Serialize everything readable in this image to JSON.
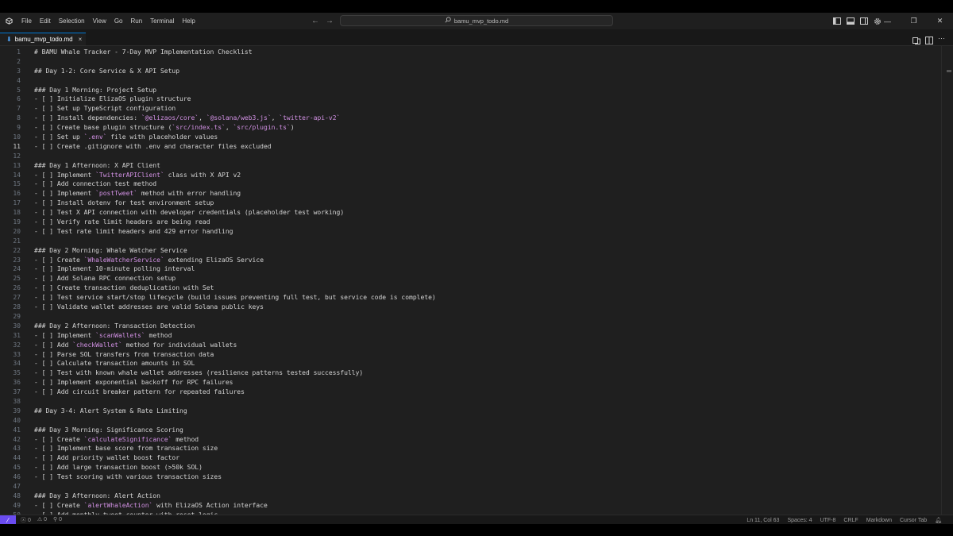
{
  "title_bar": {
    "menu": [
      "File",
      "Edit",
      "Selection",
      "View",
      "Go",
      "Run",
      "Terminal",
      "Help"
    ],
    "search": "bamu_mvp_todo.md"
  },
  "tab": {
    "filename": "bamu_mvp_todo.md",
    "close": "×"
  },
  "editor": {
    "current_line": 11,
    "lines": [
      [
        {
          "t": "# BAMU Whale Tracker - 7-Day MVP Implementation Checklist"
        }
      ],
      [],
      [
        {
          "t": "## Day 1-2: Core Service & X API Setup"
        }
      ],
      [],
      [
        {
          "t": "### Day 1 Morning: Project Setup"
        }
      ],
      [
        {
          "t": "- [ ] Initialize ElizaOS plugin structure"
        }
      ],
      [
        {
          "t": "- [ ] Set up TypeScript configuration"
        }
      ],
      [
        {
          "t": "- [ ] Install dependencies: "
        },
        {
          "t": "`@elizaos/core`",
          "h": 1
        },
        {
          "t": ", "
        },
        {
          "t": "`@solana/web3.js`",
          "h": 1
        },
        {
          "t": ", "
        },
        {
          "t": "`twitter-api-v2`",
          "h": 1
        }
      ],
      [
        {
          "t": "- [ ] Create base plugin structure ("
        },
        {
          "t": "`src/index.ts`",
          "h": 1
        },
        {
          "t": ", "
        },
        {
          "t": "`src/plugin.ts`",
          "h": 1
        },
        {
          "t": ")"
        }
      ],
      [
        {
          "t": "- [ ] Set up "
        },
        {
          "t": "`.env`",
          "h": 1
        },
        {
          "t": " file with placeholder values"
        }
      ],
      [
        {
          "t": "- [ ] Create .gitignore with .env and character files excluded"
        }
      ],
      [],
      [
        {
          "t": "### Day 1 Afternoon: X API Client"
        }
      ],
      [
        {
          "t": "- [ ] Implement "
        },
        {
          "t": "`TwitterAPIClient`",
          "h": 1
        },
        {
          "t": " class with X API v2"
        }
      ],
      [
        {
          "t": "- [ ] Add connection test method"
        }
      ],
      [
        {
          "t": "- [ ] Implement "
        },
        {
          "t": "`postTweet`",
          "h": 1
        },
        {
          "t": " method with error handling"
        }
      ],
      [
        {
          "t": "- [ ] Install dotenv for test environment setup"
        }
      ],
      [
        {
          "t": "- [ ] Test X API connection with developer credentials (placeholder test working)"
        }
      ],
      [
        {
          "t": "- [ ] Verify rate limit headers are being read"
        }
      ],
      [
        {
          "t": "- [ ] Test rate limit headers and 429 error handling"
        }
      ],
      [],
      [
        {
          "t": "### Day 2 Morning: Whale Watcher Service"
        }
      ],
      [
        {
          "t": "- [ ] Create "
        },
        {
          "t": "`WhaleWatcherService`",
          "h": 1
        },
        {
          "t": " extending ElizaOS Service"
        }
      ],
      [
        {
          "t": "- [ ] Implement 10-minute polling interval"
        }
      ],
      [
        {
          "t": "- [ ] Add Solana RPC connection setup"
        }
      ],
      [
        {
          "t": "- [ ] Create transaction deduplication with Set"
        }
      ],
      [
        {
          "t": "- [ ] Test service start/stop lifecycle (build issues preventing full test, but service code is complete)"
        }
      ],
      [
        {
          "t": "- [ ] Validate wallet addresses are valid Solana public keys"
        }
      ],
      [],
      [
        {
          "t": "### Day 2 Afternoon: Transaction Detection"
        }
      ],
      [
        {
          "t": "- [ ] Implement "
        },
        {
          "t": "`scanWallets`",
          "h": 1
        },
        {
          "t": " method"
        }
      ],
      [
        {
          "t": "- [ ] Add "
        },
        {
          "t": "`checkWallet`",
          "h": 1
        },
        {
          "t": " method for individual wallets"
        }
      ],
      [
        {
          "t": "- [ ] Parse SOL transfers from transaction data"
        }
      ],
      [
        {
          "t": "- [ ] Calculate transaction amounts in SOL"
        }
      ],
      [
        {
          "t": "- [ ] Test with known whale wallet addresses (resilience patterns tested successfully)"
        }
      ],
      [
        {
          "t": "- [ ] Implement exponential backoff for RPC failures"
        }
      ],
      [
        {
          "t": "- [ ] Add circuit breaker pattern for repeated failures"
        }
      ],
      [],
      [
        {
          "t": "## Day 3-4: Alert System & Rate Limiting"
        }
      ],
      [],
      [
        {
          "t": "### Day 3 Morning: Significance Scoring"
        }
      ],
      [
        {
          "t": "- [ ] Create "
        },
        {
          "t": "`calculateSignificance`",
          "h": 1
        },
        {
          "t": " method"
        }
      ],
      [
        {
          "t": "- [ ] Implement base score from transaction size"
        }
      ],
      [
        {
          "t": "- [ ] Add priority wallet boost factor"
        }
      ],
      [
        {
          "t": "- [ ] Add large transaction boost (>50k SOL)"
        }
      ],
      [
        {
          "t": "- [ ] Test scoring with various transaction sizes"
        }
      ],
      [],
      [
        {
          "t": "### Day 3 Afternoon: Alert Action"
        }
      ],
      [
        {
          "t": "- [ ] Create "
        },
        {
          "t": "`alertWhaleAction`",
          "h": 1
        },
        {
          "t": " with ElizaOS Action interface"
        }
      ],
      [
        {
          "t": "- [ ] Add monthly tweet counter with reset logic"
        }
      ]
    ]
  },
  "status_bar": {
    "errors": "0",
    "warnings": "0",
    "ports": "0",
    "position": "Ln 11, Col 63",
    "spaces": "Spaces: 4",
    "encoding": "UTF-8",
    "eol": "CRLF",
    "language": "Markdown",
    "cursor_tab": "Cursor Tab"
  }
}
